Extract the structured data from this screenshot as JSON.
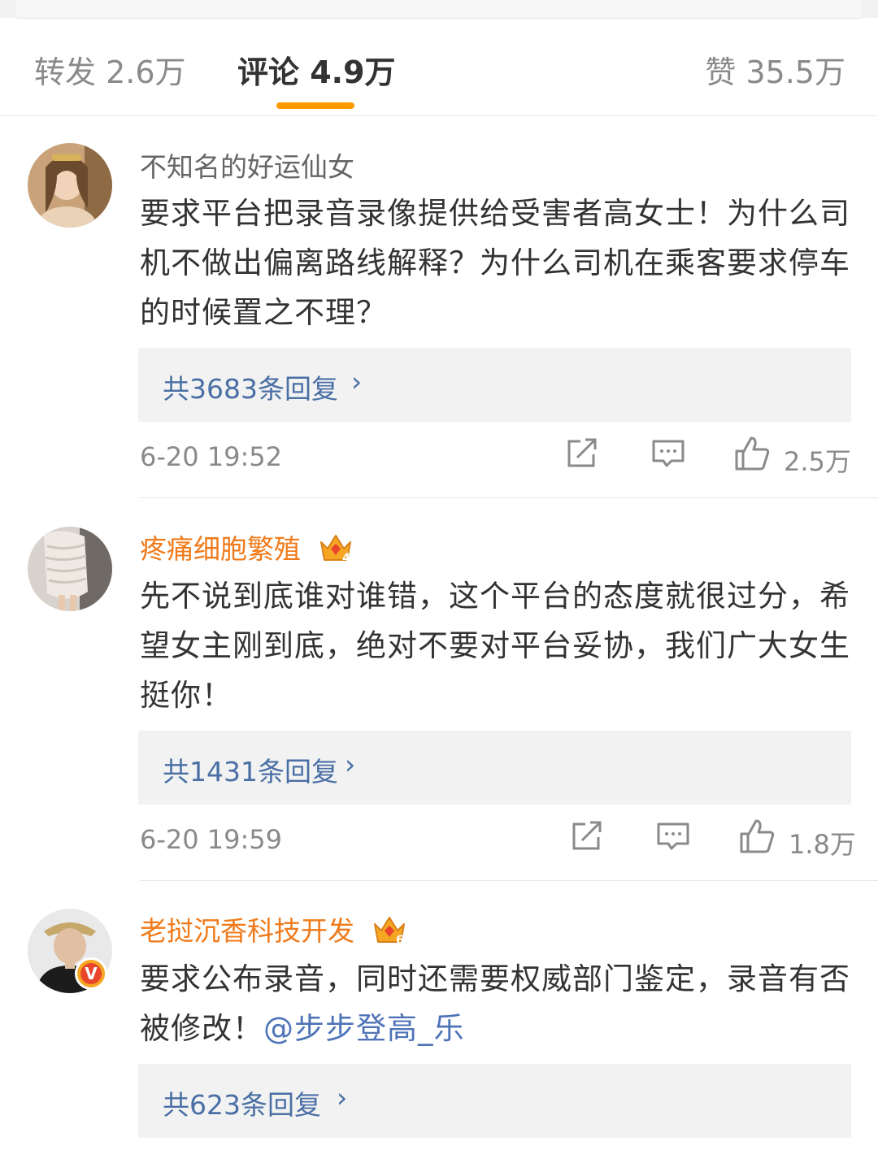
{
  "tabs": {
    "repost_label": "转发 2.6万",
    "comment_label": "评论 4.9万",
    "like_label": "赞 35.5万",
    "accent_color": "#ff9a00"
  },
  "comments": [
    {
      "username": "不知名的好运仙女",
      "content": "要求平台把录音录像提供给受害者高女士！为什么司机不做出偏离路线解释？为什么司机在乘客要求停车的时候置之不理？",
      "replies_label": "共3683条回复",
      "time": "6-20 19:52",
      "likes": "2.5万"
    },
    {
      "username": "疼痛细胞繁殖",
      "vip_level": "4",
      "content": "先不说到底谁对谁错，这个平台的态度就很过分，希望女主刚到底，绝对不要对平台妥协，我们广大女生挺你！",
      "replies_label": "共1431条回复",
      "time": "6-20 19:59",
      "likes": "1.8万"
    },
    {
      "username": "老挝沉香科技开发",
      "vip_level": "6",
      "verified_badge": "V",
      "content": "要求公布录音，同时还需要权威部门鉴定，录音有否被修改！",
      "mention": "@步步登高_乐",
      "replies_label": "共623条回复"
    }
  ],
  "icons": {
    "share": "share-icon",
    "comment": "comment-icon",
    "like": "thumbs-up-icon",
    "chevron": "chevron-right-icon",
    "crown": "vip-crown-icon"
  }
}
